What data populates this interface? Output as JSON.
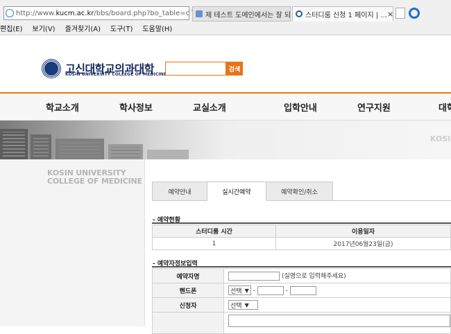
{
  "browser": {
    "url": {
      "prefix": "http://www.",
      "host": "kucm.ac.kr",
      "path": "/bbs/board.php?bo_table=cnt"
    },
    "addr_controls": "▾ ↺",
    "tabs": [
      {
        "label": "제 테스트 도메인에서는 잘 되..."
      },
      {
        "label": "스터디룸 신청 1 페이지 | ...",
        "close": "×"
      }
    ],
    "menu": [
      "편집(E)",
      "보기(V)",
      "즐겨찾기(A)",
      "도구(T)",
      "도움말(H)"
    ]
  },
  "site": {
    "logo_ko": "고신대학교의과대학",
    "logo_en": "KOSIN UNIVERSITY COLLEGE OF MEDICINE",
    "search_button": "검색",
    "nav": [
      "학교소개",
      "학사정보",
      "교실소개",
      "입학안내",
      "연구지원",
      "대학"
    ],
    "banner_text": "KOSIN",
    "side_title": [
      "KOSIN UNIVERSITY",
      "COLLEGE OF MEDICINE"
    ]
  },
  "content": {
    "tabs": [
      "예약안내",
      "실시간예약",
      "예약확인/취소"
    ],
    "section1_title": "- 예약현황",
    "res_headers": [
      "스터디룸 시간",
      "이용일자"
    ],
    "res_row": [
      "1",
      "2017년06월23일(금)"
    ],
    "section2_title": "- 예약자정보입력",
    "form": {
      "name_label": "예약자명",
      "name_hint": "(실명으로 입력해주세요)",
      "phone_label": "핸드폰",
      "phone_select": "선택",
      "phone_dash": "-",
      "applicant_label": "신청자",
      "applicant_select": "선택"
    }
  }
}
